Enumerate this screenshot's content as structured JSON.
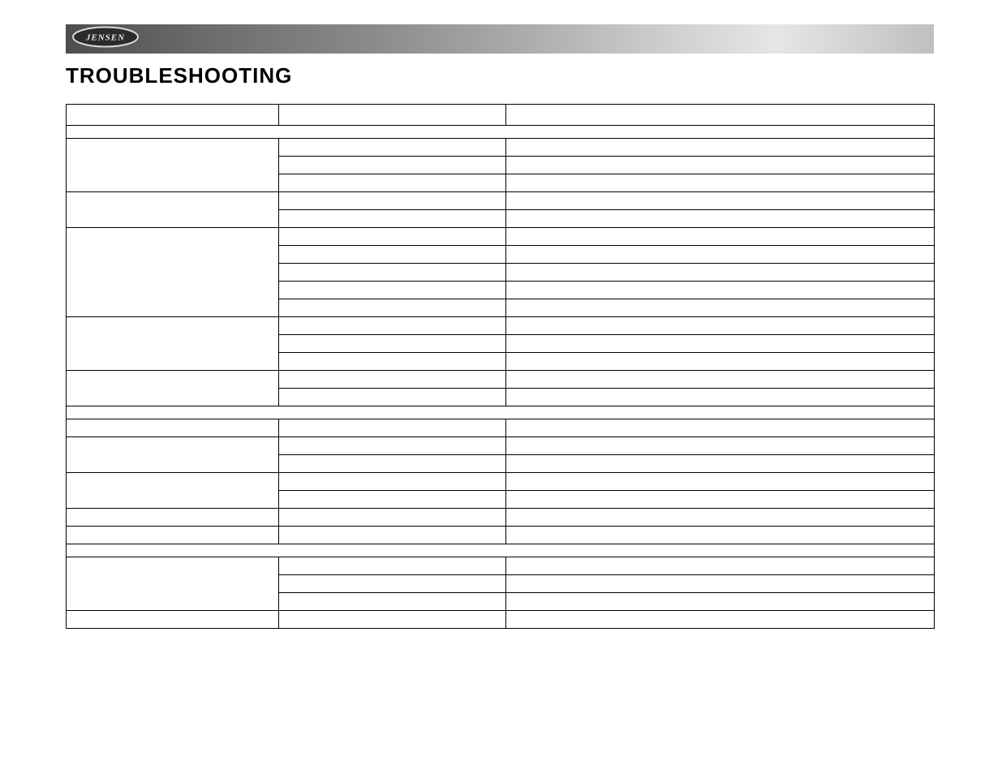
{
  "heading": "TROUBLESHOOTING",
  "logo_text": "JENSEN",
  "columns": {
    "c1": "",
    "c2": "",
    "c3": ""
  },
  "sections": [
    {
      "title": "",
      "rows": [
        {
          "problem": "",
          "cause": [
            "",
            "",
            ""
          ],
          "action": [
            "",
            "",
            ""
          ]
        },
        {
          "problem": "",
          "cause": [
            "",
            ""
          ],
          "action": [
            "",
            ""
          ]
        },
        {
          "problem": "",
          "cause": [
            "",
            "",
            "",
            "",
            ""
          ],
          "action": [
            "",
            "",
            "",
            "",
            ""
          ]
        },
        {
          "problem": "",
          "cause": [
            "",
            "",
            ""
          ],
          "action": [
            "",
            "",
            ""
          ]
        },
        {
          "problem": "",
          "cause": [
            "",
            ""
          ],
          "action": [
            "",
            ""
          ]
        }
      ]
    },
    {
      "title": "",
      "rows": [
        {
          "problem": "",
          "cause": [
            ""
          ],
          "action": [
            ""
          ]
        },
        {
          "problem": "",
          "cause": [
            "",
            ""
          ],
          "action": [
            "",
            ""
          ]
        },
        {
          "problem": "",
          "cause": [
            "",
            ""
          ],
          "action": [
            "",
            ""
          ]
        },
        {
          "problem": "",
          "cause": [
            ""
          ],
          "action": [
            ""
          ]
        },
        {
          "problem": "",
          "cause": [
            ""
          ],
          "action": [
            ""
          ]
        }
      ]
    },
    {
      "title": "",
      "rows": [
        {
          "problem": "",
          "cause": [
            "",
            "",
            ""
          ],
          "action": [
            "",
            "",
            ""
          ]
        },
        {
          "problem": "",
          "cause": [
            ""
          ],
          "action": [
            ""
          ]
        }
      ]
    }
  ]
}
